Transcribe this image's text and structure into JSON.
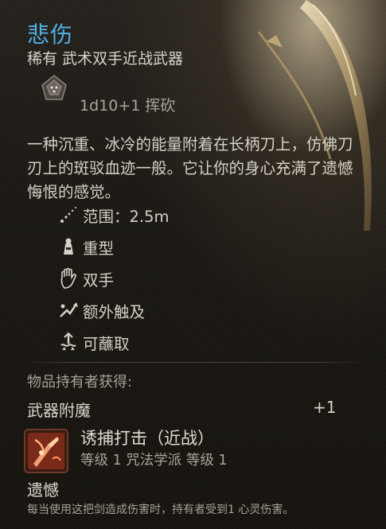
{
  "item": {
    "name": "悲伤",
    "subtitle": "稀有 武术双手近战武器",
    "damage": "1d10+1 挥砍",
    "description": "一种沉重、冰冷的能量附着在长柄刀上，仿佛刀刃上的斑驳血迹一般。它让你的身心充满了遗憾悔恨的感觉。"
  },
  "properties": [
    {
      "icon": "range-icon",
      "label": "范围：2.5m"
    },
    {
      "icon": "heavy-icon",
      "label": "重型"
    },
    {
      "icon": "two-handed-icon",
      "label": "双手"
    },
    {
      "icon": "reach-icon",
      "label": "额外触及"
    },
    {
      "icon": "dippable-icon",
      "label": "可蘸取"
    }
  ],
  "holder": {
    "gains_label": "物品持有者获得:",
    "enchant_label": "武器附魔",
    "enchant_bonus": "+1"
  },
  "skill": {
    "icon": "lacerate-skill-icon",
    "name": "诱捕打击（近战）",
    "meta": "等级 1  咒法学派  等级 1"
  },
  "passive": {
    "title": "遗憾",
    "description": "每当使用这把剑造成伤害时，持有者受到1 心灵伤害。"
  },
  "colors": {
    "name_blue": "#4fb0e6",
    "background": "#1c1915"
  }
}
